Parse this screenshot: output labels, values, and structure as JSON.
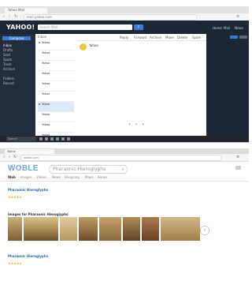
{
  "screen1": {
    "browser_tab": "Yahoo Mail",
    "url": "mail.yahoo.com",
    "app_logo": "YAHOO!",
    "search_placeholder": "Search Mail",
    "header_links": [
      "Home",
      "Mail",
      "News"
    ],
    "compose_label": "Compose",
    "folders": [
      {
        "label": "Inbox",
        "count": ""
      },
      {
        "label": "Drafts",
        "count": ""
      },
      {
        "label": "Sent",
        "count": ""
      },
      {
        "label": "Spam",
        "count": ""
      },
      {
        "label": "Trash",
        "count": ""
      },
      {
        "label": "Archive",
        "count": ""
      },
      {
        "label": "Folders",
        "count": ""
      },
      {
        "label": "Recent",
        "count": ""
      }
    ],
    "list_header": "Inbox",
    "messages": [
      {
        "from": "Yahoo",
        "date": "",
        "subject": ""
      },
      {
        "from": "Yahoo",
        "date": "",
        "subject": ""
      },
      {
        "from": "Yahoo",
        "date": "",
        "subject": ""
      },
      {
        "from": "Yahoo",
        "date": "",
        "subject": ""
      },
      {
        "from": "Yahoo",
        "date": "",
        "subject": ""
      },
      {
        "from": "Yahoo",
        "date": "",
        "subject": ""
      },
      {
        "from": "Yahoo",
        "date": "",
        "subject": ""
      },
      {
        "from": "Yahoo",
        "date": "",
        "subject": ""
      },
      {
        "from": "Yahoo",
        "date": "",
        "subject": ""
      },
      {
        "from": "Yahoo",
        "date": "",
        "subject": ""
      }
    ],
    "toolbar": [
      "Reply",
      "Forward",
      "Archive",
      "Move",
      "Delete",
      "Spam"
    ],
    "reader_from": "Yahoo",
    "reader_to": "",
    "reader_date": "",
    "body_lines": [
      "",
      "",
      "",
      "",
      "",
      "",
      "",
      "",
      "",
      "",
      "",
      ""
    ],
    "pager": "• • •",
    "taskbar_search": "Search",
    "clock": ""
  },
  "screen2": {
    "browser_tab": "Woble",
    "url": "woble.com",
    "logo": "WOBLE",
    "query": "Pharaonic Hieroglyphs",
    "tabs": [
      "Web",
      "Images",
      "Videos",
      "News",
      "Shopping",
      "Maps",
      "Books"
    ],
    "result_note": "",
    "results": [
      {
        "title": "Pharaonic Hieroglyphs",
        "url": "",
        "stars": "★★★★★",
        "snippet": ""
      },
      {
        "title": "Pharaonic Hieroglyphs",
        "url": "",
        "stars": "★★★★★",
        "snippet": ""
      }
    ],
    "images_header": "Images for Pharaonic Hieroglyphs",
    "images_footer": "",
    "carousel_arrow": "›"
  }
}
